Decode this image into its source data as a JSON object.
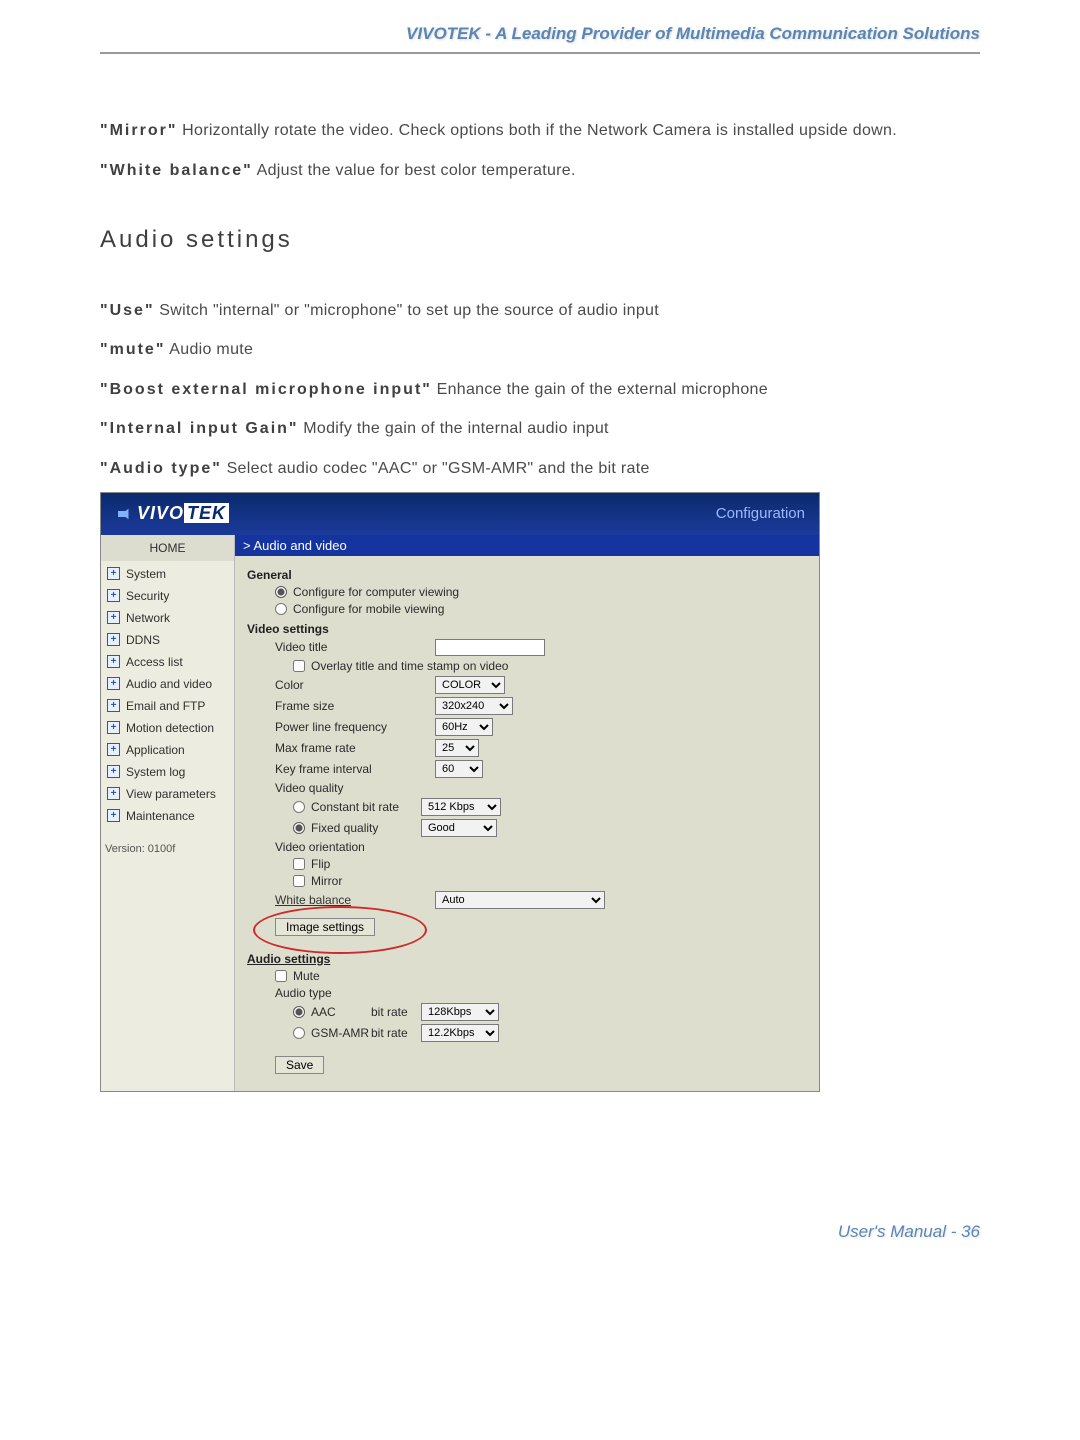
{
  "header": "VIVOTEK - A Leading Provider of Multimedia Communication Solutions",
  "intro": [
    {
      "key": "\"Mirror\"",
      "desc": " Horizontally rotate the video. Check options both if the Network Camera is installed upside down."
    },
    {
      "key": "\"White balance\"",
      "desc": " Adjust the value for best color temperature."
    }
  ],
  "section_heading": "Audio settings",
  "audio_opts": [
    {
      "key": "\"Use\"",
      "desc": " Switch \"internal\" or \"microphone\" to set up the source of audio input"
    },
    {
      "key": "\"mute\"",
      "desc": " Audio mute"
    },
    {
      "key": "\"Boost external microphone input\"",
      "desc": " Enhance the gain of the external microphone"
    },
    {
      "key": "\"Internal input Gain\"",
      "desc": " Modify the gain of the internal audio input"
    },
    {
      "key": "\"Audio type\"",
      "desc": " Select audio codec \"AAC\" or \"GSM-AMR\" and the bit rate"
    }
  ],
  "screenshot": {
    "logo_vivo": "VIVO",
    "logo_tek": "TEK",
    "config_label": "Configuration",
    "breadcrumb": "> Audio and video",
    "sidebar": {
      "home": "HOME",
      "items": [
        "System",
        "Security",
        "Network",
        "DDNS",
        "Access list",
        "Audio and video",
        "Email and FTP",
        "Motion detection",
        "Application",
        "System log",
        "View parameters",
        "Maintenance"
      ],
      "version": "Version: 0100f"
    },
    "form": {
      "general_label": "General",
      "conf_computer": "Configure for computer viewing",
      "conf_mobile": "Configure for mobile viewing",
      "video_settings_label": "Video settings",
      "video_title_label": "Video title",
      "video_title_value": "",
      "overlay_label": "Overlay title and time stamp on video",
      "color_label": "Color",
      "color_value": "COLOR",
      "frame_size_label": "Frame size",
      "frame_size_value": "320x240",
      "plf_label": "Power line frequency",
      "plf_value": "60Hz",
      "mfr_label": "Max frame rate",
      "mfr_value": "25",
      "kfi_label": "Key frame interval",
      "kfi_value": "60",
      "vq_label": "Video quality",
      "cbr_label": "Constant bit rate",
      "cbr_value": "512 Kbps",
      "fq_label": "Fixed quality",
      "fq_value": "Good",
      "orientation_label": "Video orientation",
      "flip_label": "Flip",
      "mirror_label": "Mirror",
      "wb_label": "White balance",
      "wb_value": "Auto",
      "image_settings_btn": "Image settings",
      "audio_settings_label": "Audio settings",
      "mute_label": "Mute",
      "audio_type_label": "Audio type",
      "aac_label": "AAC",
      "aac_bitrate_label": "bit rate",
      "aac_bitrate_value": "128Kbps",
      "gsm_label": "GSM-AMR",
      "gsm_bitrate_label": "bit rate",
      "gsm_bitrate_value": "12.2Kbps",
      "save_label": "Save"
    }
  },
  "footer": "User's Manual - 36"
}
